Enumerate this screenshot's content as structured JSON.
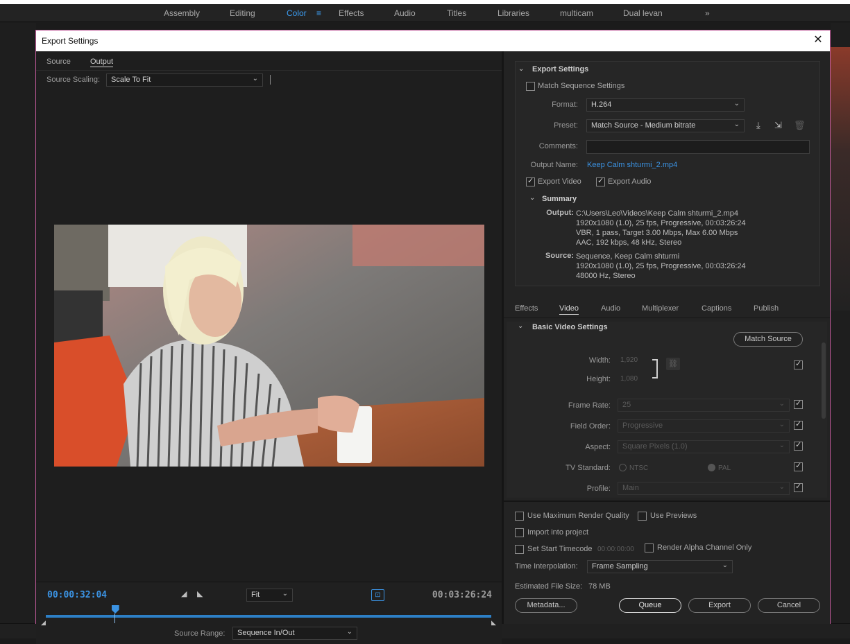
{
  "workspace_tabs": [
    "Assembly",
    "Editing",
    "Color",
    "Effects",
    "Audio",
    "Titles",
    "Libraries",
    "multicam",
    "Dual levan"
  ],
  "active_workspace": "Color",
  "dialog": {
    "title": "Export Settings",
    "close": "✕"
  },
  "left": {
    "tabs": [
      "Source",
      "Output"
    ],
    "source_scaling_label": "Source Scaling:",
    "source_scaling_value": "Scale To Fit",
    "timecode_current": "00:00:32:04",
    "timecode_total": "00:03:26:24",
    "zoom_value": "Fit",
    "source_range_label": "Source Range:",
    "source_range_value": "Sequence In/Out",
    "playhead_position": 0.156
  },
  "export_settings": {
    "header": "Export Settings",
    "match_sequence_label": "Match Sequence Settings",
    "format_label": "Format:",
    "format_value": "H.264",
    "preset_label": "Preset:",
    "preset_value": "Match Source - Medium bitrate",
    "comments_label": "Comments:",
    "output_name_label": "Output Name:",
    "output_name_value": "Keep Calm shturmi_2.mp4",
    "export_video_label": "Export Video",
    "export_audio_label": "Export Audio",
    "summary_header": "Summary",
    "output_label": "Output:",
    "output_lines": "C:\\Users\\Leo\\Videos\\Keep Calm shturmi_2.mp4\n1920x1080 (1.0), 25 fps, Progressive, 00:03:26:24\nVBR, 1 pass, Target 3.00 Mbps, Max 6.00 Mbps\nAAC, 192 kbps, 48 kHz, Stereo",
    "source_label": "Source:",
    "source_lines": "Sequence, Keep Calm shturmi\n1920x1080 (1.0), 25 fps, Progressive, 00:03:26:24\n48000 Hz, Stereo"
  },
  "settings_tabs": [
    "Effects",
    "Video",
    "Audio",
    "Multiplexer",
    "Captions",
    "Publish"
  ],
  "active_settings_tab": "Video",
  "basic_video": {
    "header": "Basic Video Settings",
    "match_source_button": "Match Source",
    "width_label": "Width:",
    "width_value": "1,920",
    "height_label": "Height:",
    "height_value": "1,080",
    "frame_rate_label": "Frame Rate:",
    "frame_rate_value": "25",
    "field_order_label": "Field Order:",
    "field_order_value": "Progressive",
    "aspect_label": "Aspect:",
    "aspect_value": "Square Pixels (1.0)",
    "tv_standard_label": "TV Standard:",
    "ntsc_label": "NTSC",
    "pal_label": "PAL",
    "profile_label": "Profile:",
    "profile_value": "Main"
  },
  "bottom": {
    "max_render_quality": "Use Maximum Render Quality",
    "use_previews": "Use Previews",
    "import_into_project": "Import into project",
    "set_start_timecode": "Set Start Timecode",
    "start_timecode_value": "00:00:00:00",
    "render_alpha": "Render Alpha Channel Only",
    "time_interp_label": "Time Interpolation:",
    "time_interp_value": "Frame Sampling",
    "file_size_label": "Estimated File Size:",
    "file_size_value": "78 MB",
    "metadata_button": "Metadata...",
    "queue_button": "Queue",
    "export_button": "Export",
    "cancel_button": "Cancel"
  }
}
